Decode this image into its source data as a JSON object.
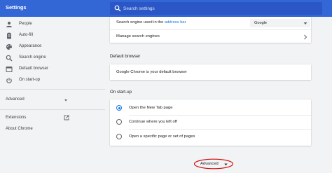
{
  "header": {
    "title": "Settings",
    "search_placeholder": "Search settings"
  },
  "sidebar": {
    "items": [
      {
        "label": "People",
        "icon": "person-icon"
      },
      {
        "label": "Auto-fill",
        "icon": "clipboard-icon"
      },
      {
        "label": "Appearance",
        "icon": "palette-icon"
      },
      {
        "label": "Search engine",
        "icon": "search-icon"
      },
      {
        "label": "Default browser",
        "icon": "browser-window-icon"
      },
      {
        "label": "On start-up",
        "icon": "power-icon"
      }
    ],
    "advanced_label": "Advanced",
    "extensions_label": "Extensions",
    "about_label": "About Chrome"
  },
  "search_engine": {
    "prefix": "Search engine used in the ",
    "link": "address bar",
    "selected": "Google",
    "manage_label": "Manage search engines"
  },
  "default_browser": {
    "title": "Default browser",
    "status": "Google Chrome is your default browser"
  },
  "startup": {
    "title": "On start-up",
    "options": [
      {
        "label": "Open the New Tab page",
        "checked": true
      },
      {
        "label": "Continue where you left off",
        "checked": false
      },
      {
        "label": "Open a specific page or set of pages",
        "checked": false
      }
    ]
  },
  "advanced_button": {
    "label": "Advanced",
    "highlight_color": "#d50000"
  },
  "colors": {
    "header": "#3367d6",
    "accent": "#1a73e8",
    "background": "#f1f3f4"
  }
}
